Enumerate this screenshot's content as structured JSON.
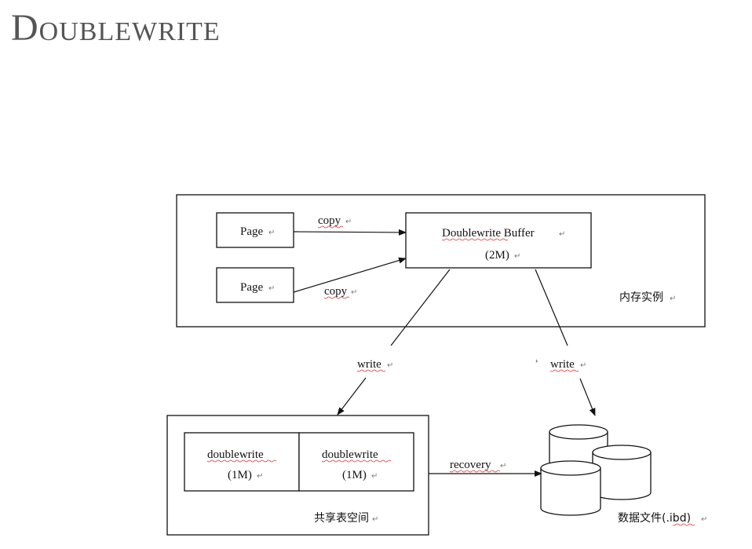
{
  "title": "Doublewrite",
  "pilcrow": "↵",
  "memory": {
    "label": "内存实例",
    "pages": [
      "Page",
      "Page"
    ],
    "copy_labels": [
      "copy",
      "copy"
    ],
    "buffer": {
      "name": "Doublewrite Buffer",
      "size": "(2M)"
    }
  },
  "write_labels": [
    "write",
    "write"
  ],
  "stray_mark": "ʾ",
  "shared": {
    "label": "共享表空间",
    "cells": [
      {
        "name": "doublewrite",
        "size": "(1M)"
      },
      {
        "name": "doublewrite",
        "size": "(1M)"
      }
    ]
  },
  "recovery_label": "recovery",
  "datafile_label": "数据文件(.ibd)"
}
